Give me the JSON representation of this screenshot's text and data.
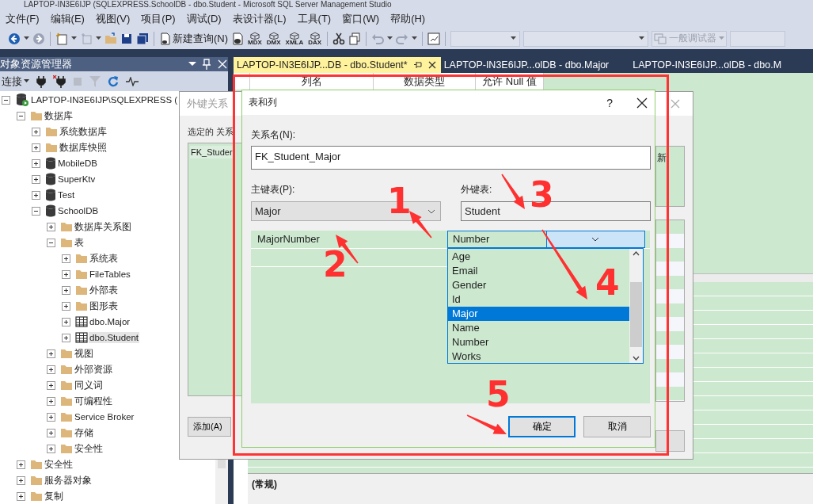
{
  "window": {
    "title": "LAPTOP-IN3E6IJP (SQLEXPRESS.SchoolDB - dbo.Student - Microsoft SQL Server Management Studio"
  },
  "menu": [
    "文件(F)",
    "编辑(E)",
    "视图(V)",
    "项目(P)",
    "调试(D)",
    "表设计器(L)",
    "工具(T)",
    "窗口(W)",
    "帮助(H)"
  ],
  "toolbar": {
    "new_query": "新建查询(N)",
    "query_types": [
      "MDX",
      "DMX",
      "XMLA",
      "DAX"
    ],
    "debugger": {
      "label": "一般调试器",
      "disabled": true
    }
  },
  "object_explorer": {
    "title": "对象资源管理器",
    "connect": "连接",
    "tree": [
      {
        "label": "LAPTOP-IN3E6IJP\\SQLEXPRESS (",
        "kind": "server",
        "expanded": true,
        "selected": false,
        "children": [
          {
            "label": "数据库",
            "kind": "folder",
            "expanded": true,
            "selected": false,
            "children": [
              {
                "label": "系统数据库",
                "kind": "folder",
                "expanded": false,
                "selected": false
              },
              {
                "label": "数据库快照",
                "kind": "folder",
                "expanded": false,
                "selected": false
              },
              {
                "label": "MobileDB",
                "kind": "database",
                "expanded": false,
                "selected": false
              },
              {
                "label": "SuperKtv",
                "kind": "database",
                "expanded": false,
                "selected": false
              },
              {
                "label": "Test",
                "kind": "database",
                "expanded": false,
                "selected": false
              },
              {
                "label": "SchoolDB",
                "kind": "database",
                "expanded": true,
                "selected": false,
                "children": [
                  {
                    "label": "数据库关系图",
                    "kind": "folder",
                    "expanded": false,
                    "selected": false
                  },
                  {
                    "label": "表",
                    "kind": "folder",
                    "expanded": true,
                    "selected": false,
                    "children": [
                      {
                        "label": "系统表",
                        "kind": "folder",
                        "expanded": false,
                        "selected": false
                      },
                      {
                        "label": "FileTables",
                        "kind": "folder",
                        "expanded": false,
                        "selected": false
                      },
                      {
                        "label": "外部表",
                        "kind": "folder",
                        "expanded": false,
                        "selected": false
                      },
                      {
                        "label": "图形表",
                        "kind": "folder",
                        "expanded": false,
                        "selected": false
                      },
                      {
                        "label": "dbo.Major",
                        "kind": "table",
                        "expanded": false,
                        "selected": false
                      },
                      {
                        "label": "dbo.Student",
                        "kind": "table",
                        "expanded": false,
                        "selected": true
                      }
                    ]
                  },
                  {
                    "label": "视图",
                    "kind": "folder",
                    "expanded": false,
                    "selected": false
                  },
                  {
                    "label": "外部资源",
                    "kind": "folder",
                    "expanded": false,
                    "selected": false
                  },
                  {
                    "label": "同义词",
                    "kind": "folder",
                    "expanded": false,
                    "selected": false
                  },
                  {
                    "label": "可编程性",
                    "kind": "folder",
                    "expanded": false,
                    "selected": false
                  },
                  {
                    "label": "Service Broker",
                    "kind": "folder",
                    "expanded": false,
                    "selected": false
                  },
                  {
                    "label": "存储",
                    "kind": "folder",
                    "expanded": false,
                    "selected": false
                  },
                  {
                    "label": "安全性",
                    "kind": "folder",
                    "expanded": false,
                    "selected": false
                  }
                ]
              }
            ]
          },
          {
            "label": "安全性",
            "kind": "folder",
            "expanded": false,
            "selected": false
          },
          {
            "label": "服务器对象",
            "kind": "folder",
            "expanded": false,
            "selected": false
          },
          {
            "label": "复制",
            "kind": "folder",
            "expanded": false,
            "selected": false
          }
        ]
      }
    ]
  },
  "tabs": [
    {
      "label": "LAPTOP-IN3E6IJP...DB - dbo.Student*",
      "selected": true
    },
    {
      "label": "LAPTOP-IN3E6IJP...olDB - dbo.Major",
      "selected": false
    },
    {
      "label": "LAPTOP-IN3E6IJP...olDB - dbo.M",
      "selected": false
    }
  ],
  "designer": {
    "columns": [
      "列名",
      "数据类型",
      "允许 Null 值"
    ]
  },
  "properties": {
    "category": "(常规)"
  },
  "fk_dialog": {
    "title": "外键关系",
    "selected_label": "选定的 关系",
    "relations": [
      "FK_Studer"
    ],
    "side_text": "新",
    "add_button": "添加(A)"
  },
  "table_columns_dialog": {
    "title": "表和列",
    "help": "?",
    "relation_name_label": "关系名(N):",
    "relation_name": "FK_Student_Major",
    "primary_table_label": "主键表(P):",
    "primary_table": "Major",
    "foreign_table_label": "外键表:",
    "foreign_table": "Student",
    "primary_column": "MajorNumber",
    "foreign_column": "Number",
    "foreign_column_options": [
      {
        "label": "Age",
        "selected": false
      },
      {
        "label": "Email",
        "selected": false
      },
      {
        "label": "Gender",
        "selected": false
      },
      {
        "label": "Id",
        "selected": false
      },
      {
        "label": "Major",
        "selected": true
      },
      {
        "label": "Name",
        "selected": false
      },
      {
        "label": "Number",
        "selected": false
      },
      {
        "label": "Works",
        "selected": false
      }
    ],
    "buttons": [
      {
        "label": "确定",
        "default": true
      },
      {
        "label": "取消",
        "default": false
      }
    ]
  },
  "annotations": [
    {
      "label": "1"
    },
    {
      "label": "2"
    },
    {
      "label": "3"
    },
    {
      "label": "4"
    },
    {
      "label": "5"
    }
  ]
}
